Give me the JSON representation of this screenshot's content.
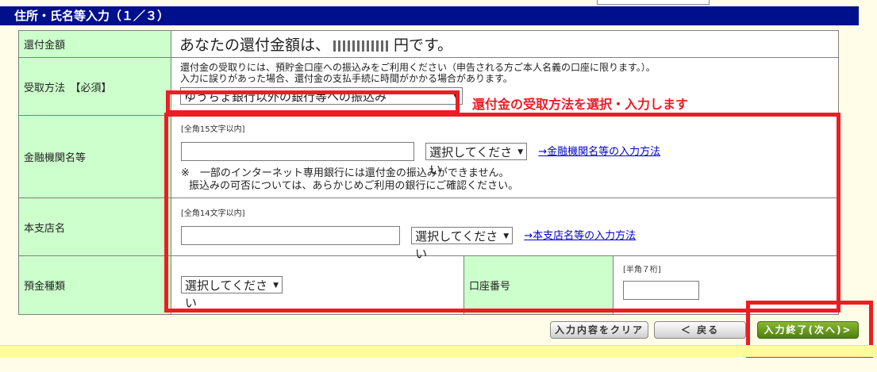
{
  "header": {
    "title": "住所・氏名等入力（１／３）"
  },
  "refund": {
    "label": "還付金額",
    "prefix": "あなたの還付金額は、",
    "suffix": "円です。"
  },
  "receive": {
    "label": "受取方法　【必須】",
    "note_line1": "還付金の受取りには、預貯金口座への振込みをご利用ください（申告される方ご本人名義の口座に限ります。）。",
    "note_line2": "入力に誤りがあった場合、還付金の支払手続に時間がかかる場合があります。",
    "selected": "ゆうちょ銀行以外の銀行等への振込み",
    "annotation": "還付金の受取方法を選択・入力します"
  },
  "bank": {
    "label": "金融機関名等",
    "hint": "[全角15文字以内]",
    "select": "選択してください",
    "help_link": "→金融機関名等の入力方法",
    "warn_line1": "※　一部のインターネット専用銀行には還付金の振込みができません。",
    "warn_line2": "振込みの可否については、あらかじめご利用の銀行にご確認ください。"
  },
  "branch": {
    "label": "本支店名",
    "hint": "[全角14文字以内]",
    "select": "選択してください",
    "help_link": "→本支店名等の入力方法"
  },
  "deposit": {
    "label": "預金種類",
    "select": "選択してください"
  },
  "account": {
    "label": "口座番号",
    "hint": "[半角７桁]"
  },
  "buttons": {
    "clear": "入力内容をクリア",
    "back": "＜ 戻る",
    "next": "入力終了(次へ)>"
  },
  "colors": {
    "header_bg": "#000f8c",
    "label_bg": "#ccffcc",
    "highlight": "#ee1c24",
    "next_btn": "#5b8c1a"
  }
}
